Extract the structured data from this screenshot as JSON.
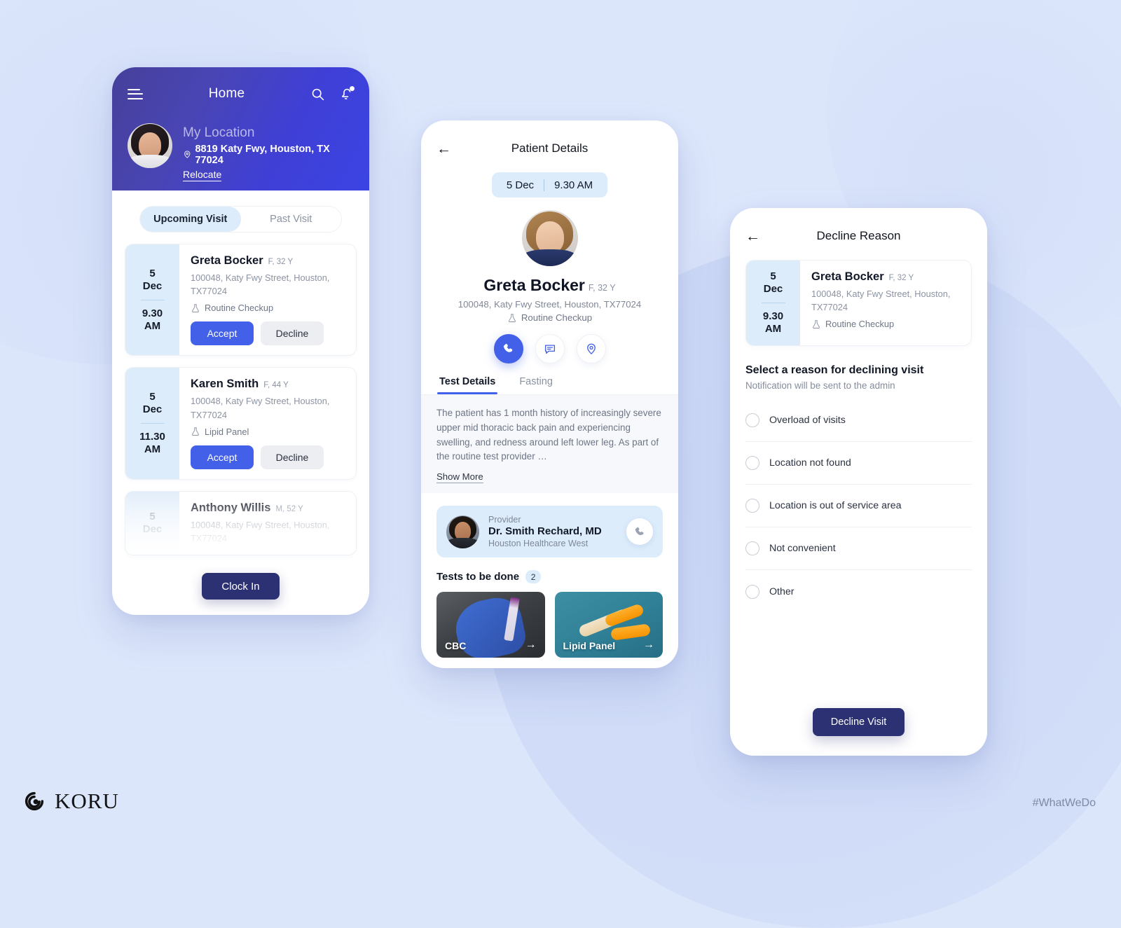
{
  "brand": {
    "name": "KORU",
    "hashtag": "#WhatWeDo",
    "accent": "#4361e8",
    "navy": "#2c3173",
    "light_blue": "#dcecfb",
    "bg": "#dce6fb"
  },
  "phone1": {
    "header": {
      "title": "Home",
      "menu_icon": "hamburger-icon",
      "search_icon": "search-icon",
      "bell_icon": "bell-icon",
      "location_label": "My Location",
      "location_address": "8819 Katy Fwy, Houston, TX 77024",
      "relocate_label": "Relocate"
    },
    "tabs": [
      {
        "label": "Upcoming Visit",
        "active": true
      },
      {
        "label": "Past Visit",
        "active": false
      }
    ],
    "visits": [
      {
        "day": "5",
        "month": "Dec",
        "time_h": "9.30",
        "time_m": "AM",
        "name": "Greta Bocker",
        "meta": "F, 32 Y",
        "address": "100048, Katy Fwy Street, Houston, TX77024",
        "test": "Routine Checkup",
        "accept_label": "Accept",
        "decline_label": "Decline"
      },
      {
        "day": "5",
        "month": "Dec",
        "time_h": "11.30",
        "time_m": "AM",
        "name": "Karen Smith",
        "meta": "F, 44 Y",
        "address": "100048, Katy Fwy Street, Houston, TX77024",
        "test": "Lipid Panel",
        "accept_label": "Accept",
        "decline_label": "Decline"
      },
      {
        "day": "5",
        "month": "Dec",
        "time_h": "",
        "time_m": "",
        "name": "Anthony Willis",
        "meta": "M, 52 Y",
        "address": "100048, Katy Fwy Street, Houston, TX77024",
        "test": "",
        "accept_label": "",
        "decline_label": ""
      }
    ],
    "clock_in_label": "Clock In"
  },
  "phone2": {
    "nav": {
      "title": "Patient Details",
      "back_icon": "back-arrow-icon"
    },
    "appointment": {
      "date": "5 Dec",
      "time": "9.30 AM"
    },
    "patient": {
      "name": "Greta Bocker",
      "meta": "F, 32 Y",
      "address": "100048, Katy Fwy Street, Houston, TX77024",
      "test": "Routine Checkup"
    },
    "actions": [
      {
        "name": "call-action",
        "icon": "phone-icon",
        "primary": true
      },
      {
        "name": "message-action",
        "icon": "message-icon",
        "primary": false
      },
      {
        "name": "location-action",
        "icon": "location-pin-icon",
        "primary": false
      }
    ],
    "tabs": [
      {
        "label": "Test Details",
        "active": true
      },
      {
        "label": "Fasting",
        "active": false
      }
    ],
    "description": "The patient has 1 month history of increasingly severe upper mid thoracic back pain and experiencing swelling, and redness around left lower leg. As part of the routine test provider …",
    "show_more_label": "Show More",
    "provider": {
      "label": "Provider",
      "name": "Dr. Smith Rechard, MD",
      "org": "Houston Healthcare West",
      "call_icon": "phone-icon"
    },
    "tests_section": {
      "title": "Tests to be done",
      "count": "2",
      "items": [
        {
          "label": "CBC",
          "arrow": "arrow-right-icon"
        },
        {
          "label": "Lipid Panel",
          "arrow": "arrow-right-icon"
        }
      ]
    }
  },
  "phone3": {
    "nav": {
      "title": "Decline Reason",
      "back_icon": "back-arrow-icon"
    },
    "visit": {
      "day": "5",
      "month": "Dec",
      "time_h": "9.30",
      "time_m": "AM",
      "name": "Greta Bocker",
      "meta": "F, 32 Y",
      "address": "100048, Katy Fwy Street, Houston, TX77024",
      "test": "Routine Checkup"
    },
    "section": {
      "title": "Select a reason for declining visit",
      "subtitle": "Notification will be sent to the admin"
    },
    "reasons": [
      {
        "label": "Overload of visits",
        "selected": false
      },
      {
        "label": "Location not found",
        "selected": false
      },
      {
        "label": "Location is out of service area",
        "selected": false
      },
      {
        "label": "Not convenient",
        "selected": false
      },
      {
        "label": "Other",
        "selected": false
      }
    ],
    "submit_label": "Decline Visit"
  }
}
